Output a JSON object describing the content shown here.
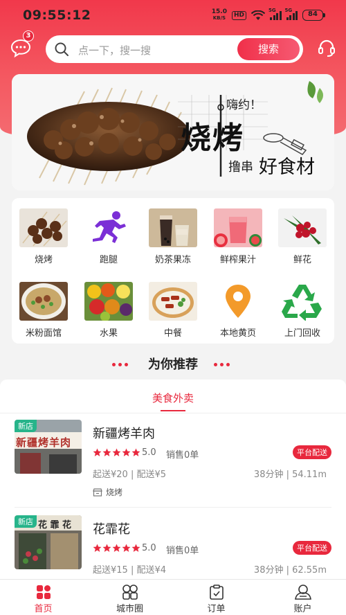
{
  "status_bar": {
    "time": "09:55:12",
    "net_speed_value": "15.0",
    "net_speed_unit": "KB/S",
    "hd": "HD",
    "signal_1": "5G",
    "signal_2": "5G",
    "battery": "84"
  },
  "header": {
    "message_badge": "3",
    "search_placeholder": "点一下，搜一搜",
    "search_button": "搜索"
  },
  "banner": {
    "greeting": "嗨约！",
    "headline": "烧烤",
    "tagline_prefix": "撸串",
    "tagline_main": "好食材"
  },
  "categories": [
    {
      "label": "烧烤",
      "icon": "bbq-image"
    },
    {
      "label": "跑腿",
      "icon": "runner-icon"
    },
    {
      "label": "奶茶果冻",
      "icon": "milk-tea-image"
    },
    {
      "label": "鲜榨果汁",
      "icon": "juice-image"
    },
    {
      "label": "鲜花",
      "icon": "flowers-image"
    },
    {
      "label": "米粉面馆",
      "icon": "noodles-image"
    },
    {
      "label": "水果",
      "icon": "fruit-image"
    },
    {
      "label": "中餐",
      "icon": "chinese-food-image"
    },
    {
      "label": "本地黄页",
      "icon": "location-pin-icon"
    },
    {
      "label": "上门回收",
      "icon": "recycle-icon"
    }
  ],
  "recommend": {
    "title": "为你推荐",
    "active_tab": "美食外卖"
  },
  "stores": [
    {
      "tag": "新店",
      "name": "新疆烤羊肉",
      "sign_text": "新疆烤羊肉",
      "rating": "5.0",
      "sales": "销售0单",
      "delivery": "平台配送",
      "fees": "起送¥20 | 配送¥5",
      "eta": "38分钟 | 54.11m",
      "category": "烧烤"
    },
    {
      "tag": "新店",
      "name": "花霏花",
      "sign_text": "花 霏 花",
      "rating": "5.0",
      "sales": "销售0单",
      "delivery": "平台配送",
      "fees": "起送¥15 | 配送¥4",
      "eta": "38分钟 | 62.55m"
    }
  ],
  "bottom_nav": [
    {
      "label": "首页",
      "icon": "home-grid-icon",
      "active": true
    },
    {
      "label": "城市圈",
      "icon": "city-circle-icon"
    },
    {
      "label": "订单",
      "icon": "order-clipboard-icon"
    },
    {
      "label": "账户",
      "icon": "account-user-icon"
    }
  ],
  "colors": {
    "accent": "#e8283d",
    "header_gradient_top": "#f1384b",
    "new_tag": "#27b48a"
  }
}
